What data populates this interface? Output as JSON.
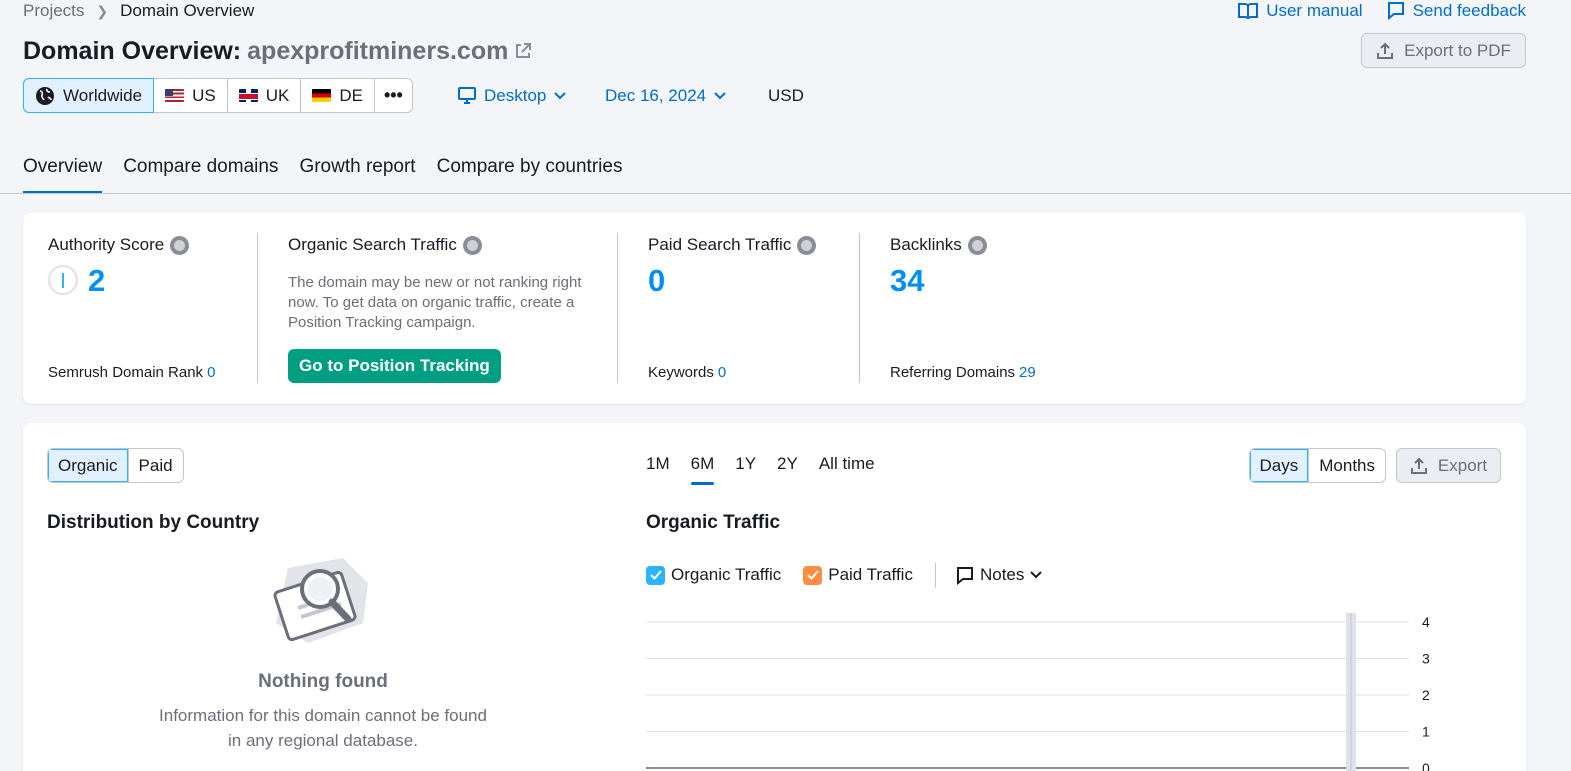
{
  "breadcrumb": {
    "root": "Projects",
    "current": "Domain Overview"
  },
  "top_links": {
    "manual": "User manual",
    "feedback": "Send feedback"
  },
  "header": {
    "title_prefix": "Domain Overview:",
    "domain": "apexprofitminers.com",
    "export_pdf": "Export to PDF"
  },
  "databases": [
    {
      "label": "Worldwide",
      "icon": "globe-icon"
    },
    {
      "label": "US",
      "icon": "us-flag-icon"
    },
    {
      "label": "UK",
      "icon": "uk-flag-icon"
    },
    {
      "label": "DE",
      "icon": "de-flag-icon"
    }
  ],
  "filters": {
    "device": "Desktop",
    "date": "Dec 16, 2024",
    "currency": "USD"
  },
  "tabs": [
    "Overview",
    "Compare domains",
    "Growth report",
    "Compare by countries"
  ],
  "summary": {
    "authority": {
      "label": "Authority Score",
      "value": "2",
      "rank_label": "Semrush Domain Rank",
      "rank_value": "0"
    },
    "organic": {
      "label": "Organic Search Traffic",
      "desc": "The domain may be new or not ranking right now. To get data on organic traffic, create a Position Tracking campaign.",
      "button": "Go to Position Tracking"
    },
    "paid": {
      "label": "Paid Search Traffic",
      "value": "0",
      "keywords_label": "Keywords",
      "keywords_value": "0"
    },
    "backlinks": {
      "label": "Backlinks",
      "value": "34",
      "ref_label": "Referring Domains",
      "ref_value": "29"
    }
  },
  "main": {
    "type_toggle": [
      "Organic",
      "Paid"
    ],
    "periods": [
      "1M",
      "6M",
      "1Y",
      "2Y",
      "All time"
    ],
    "granularity": [
      "Days",
      "Months"
    ],
    "export": "Export",
    "distribution_title": "Distribution by Country",
    "empty_title": "Nothing found",
    "empty_desc": "Information for this domain cannot be found in any regional database.",
    "traffic_title": "Organic Traffic",
    "legend": {
      "organic": "Organic Traffic",
      "paid": "Paid Traffic",
      "notes": "Notes"
    },
    "y_ticks": [
      "4",
      "3",
      "2",
      "1",
      "0"
    ]
  },
  "colors": {
    "accent": "#006dca",
    "number": "#008ff8",
    "green": "#009f81",
    "organic": "#2bb3ff",
    "paid": "#ff8c43"
  }
}
